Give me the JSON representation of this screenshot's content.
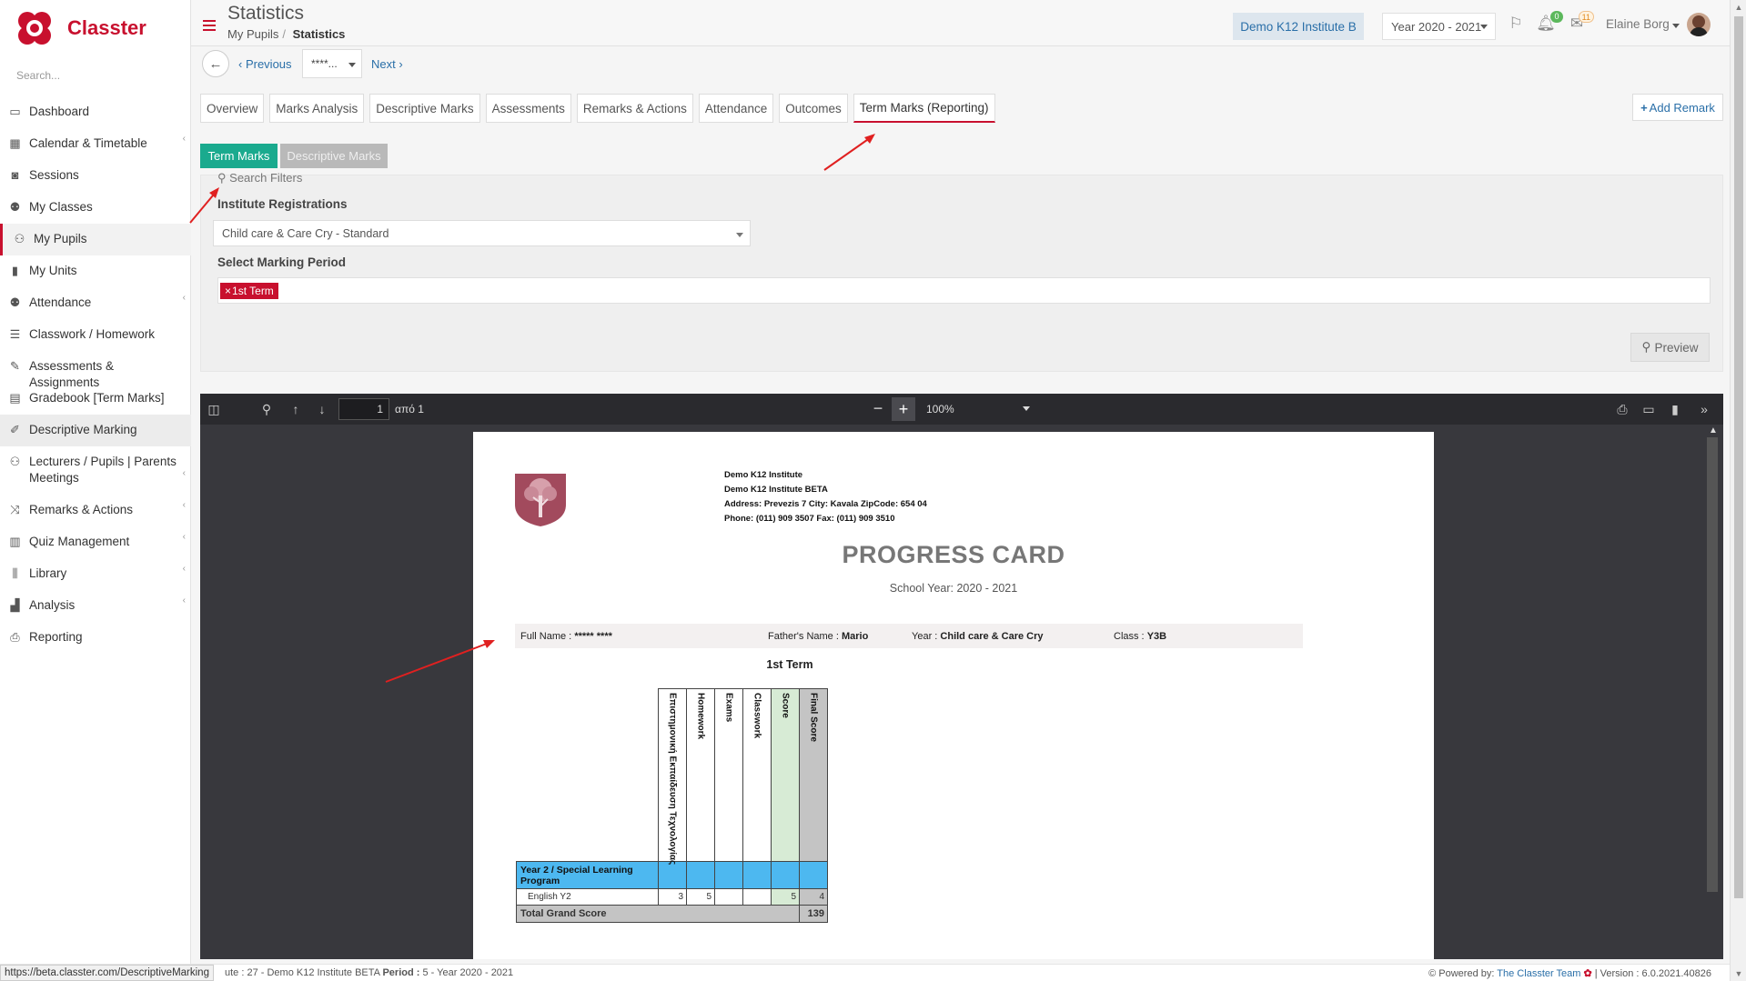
{
  "app": {
    "name": "Classter",
    "brand_color": "#c8102e",
    "search_placeholder": "Search..."
  },
  "sidebar": {
    "items": [
      {
        "label": "Dashboard",
        "icon": "laptop-icon"
      },
      {
        "label": "Calendar & Timetable",
        "icon": "calendar-icon"
      },
      {
        "label": "Sessions",
        "icon": "sessions-icon"
      },
      {
        "label": "My Classes",
        "icon": "classes-icon"
      },
      {
        "label": "My Pupils",
        "icon": "pupils-icon"
      },
      {
        "label": "My Units",
        "icon": "book-icon"
      },
      {
        "label": "Attendance",
        "icon": "attendance-icon"
      },
      {
        "label": "Classwork / Homework",
        "icon": "list-icon"
      },
      {
        "label": "Assessments & Assignments",
        "icon": "edit-icon"
      },
      {
        "label": "Gradebook [Term Marks]",
        "icon": "gradebook-icon"
      },
      {
        "label": "Descriptive Marking",
        "icon": "marking-icon"
      },
      {
        "label": "Lecturers / Pupils | Parents Meetings",
        "icon": "meetings-icon"
      },
      {
        "label": "Remarks & Actions",
        "icon": "remarks-icon"
      },
      {
        "label": "Quiz Management",
        "icon": "quiz-icon"
      },
      {
        "label": "Library",
        "icon": "library-icon"
      },
      {
        "label": "Analysis",
        "icon": "chart-icon"
      },
      {
        "label": "Reporting",
        "icon": "printer-icon"
      }
    ]
  },
  "header": {
    "title": "Statistics",
    "breadcrumb_parent": "My Pupils",
    "breadcrumb_current": "Statistics",
    "institute": "Demo K12 Institute B",
    "year": "Year 2020 - 2021",
    "notifications_count": "0",
    "messages_count": "11",
    "user_name": "Elaine Borg"
  },
  "pupil_nav": {
    "previous": "Previous",
    "pupil": "****...",
    "next": "Next"
  },
  "tabs": [
    "Overview",
    "Marks Analysis",
    "Descriptive Marks",
    "Assessments",
    "Remarks & Actions",
    "Attendance",
    "Outcomes",
    "Term Marks (Reporting)"
  ],
  "add_remark": "Add Remark",
  "subtabs": {
    "term_marks": "Term Marks",
    "descriptive_marks": "Descriptive Marks"
  },
  "filters": {
    "search_filters": "Search Filters",
    "registrations_label": "Institute Registrations",
    "registration_value": "Child care & Care Cry - Standard",
    "marking_period_label": "Select Marking Period",
    "marking_period_tag": "1st Term",
    "preview": "Preview"
  },
  "viewer": {
    "page": "1",
    "page_of": "από 1",
    "zoom": "100%"
  },
  "report": {
    "school_lines": [
      "Demo K12 Institute",
      "Demo K12 Institute BETA",
      "Address: Prevezis 7 City: Kavala ZipCode: 654 04",
      "Phone: (011) 909 3507 Fax: (011) 909 3510"
    ],
    "title": "PROGRESS CARD",
    "school_year": "School Year: 2020 - 2021",
    "full_name_label": "Full Name :",
    "full_name_value": "***** ****",
    "father_label": "Father's Name :",
    "father_value": "Mario",
    "year_label": "Year :",
    "year_value": "Child care & Care Cry",
    "class_label": "Class :",
    "class_value": "Y3B",
    "term": "1st Term",
    "columns": [
      "Επιστημονική Εκπαίδευση Τεχνολογίας",
      "Homework",
      "Exams",
      "Classwork",
      "Score",
      "Final Score"
    ],
    "section": "Year 2 / Special Learning Program",
    "subject": {
      "name": "English Y2",
      "values": [
        "3",
        "5",
        "",
        "",
        "5",
        "4"
      ]
    },
    "total_label": "Total Grand Score",
    "total_value": "139"
  },
  "footer": {
    "status_url": "https://beta.classter.com/DescriptiveMarking",
    "left_prefix": "ute : 27 - Demo K12 Institute BETA",
    "period_label": "Period :",
    "period_value": "5 - Year 2020 - 2021",
    "powered_label": "Powered by:",
    "powered_team": "The Classter Team",
    "version": "| Version : 6.0.2021.40826"
  }
}
